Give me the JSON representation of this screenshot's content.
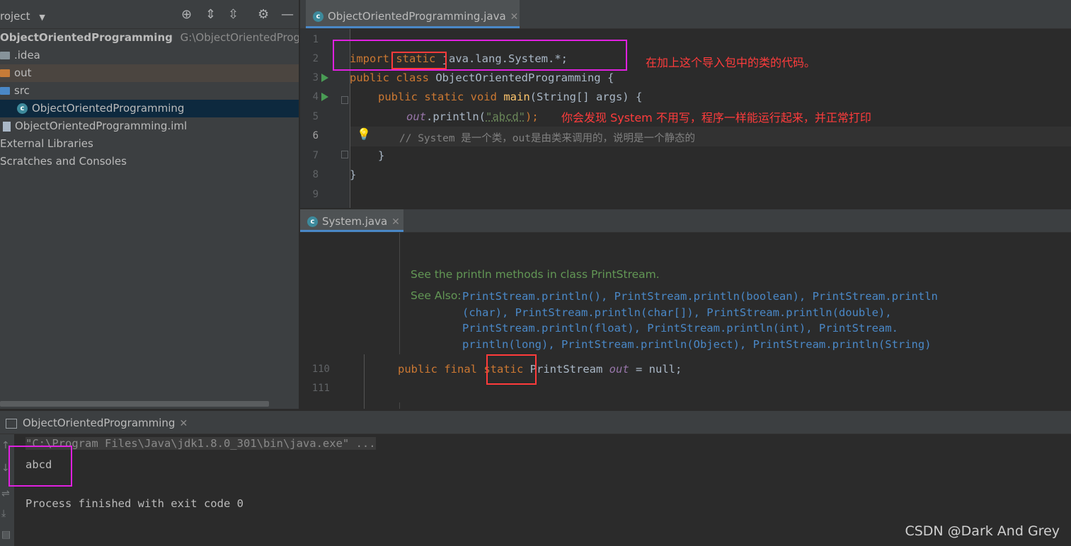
{
  "project": {
    "header": "roject",
    "tree": [
      {
        "label": ".idea",
        "icon": "folder-icon"
      },
      {
        "label": "out",
        "icon": "folder-icon"
      },
      {
        "label": "src",
        "icon": "folder-icon"
      },
      {
        "label": "ObjectOrientedProgramming",
        "icon": "java-class-icon"
      },
      {
        "label": "ObjectOrientedProgramming.iml",
        "icon": "file-icon"
      },
      {
        "label": "External Libraries",
        "icon": ""
      },
      {
        "label": "Scratches and Consoles",
        "icon": ""
      }
    ],
    "root_name": "ObjectOrientedProgramming",
    "root_path": "G:\\ObjectOrientedProgram"
  },
  "editor": {
    "tab_label": "ObjectOrientedProgramming.java",
    "line_numbers": [
      "1",
      "2",
      "3",
      "4",
      "5",
      "6",
      "7",
      "8",
      "9"
    ],
    "code": {
      "l2_import": "import",
      "l2_static": "static",
      "l2_rest": "java.lang.System.*;",
      "l3_kw": "public class",
      "l3_name": "ObjectOrientedProgramming {",
      "l4_kw": "public static void",
      "l4_main": "main",
      "l4_rest": "(String[] args) {",
      "l5_out": "out",
      "l5_call": ".println(",
      "l5_str": "\"abcd\"",
      "l5_end": ");",
      "l6_comment": "// System 是一个类，out是由类来调用的，说明是一个静态的",
      "l7": "}",
      "l8": "}"
    },
    "annotation_1": "在加上这个导入包中的类的代码。",
    "annotation_2": "你会发现 System 不用写，程序一样能运行起来，并正常打印"
  },
  "editor2": {
    "tab_label": "System.java",
    "doc_text": "See the println methods in class PrintStream.",
    "see_also_label": "See Also:",
    "see_also_lines": [
      "PrintStream.println(), PrintStream.println(boolean), PrintStream.println",
      "(char), PrintStream.println(char[]), PrintStream.println(double),",
      "PrintStream.println(float), PrintStream.println(int), PrintStream.",
      "println(long), PrintStream.println(Object), PrintStream.println(String)"
    ],
    "ln_110": "110",
    "ln_111": "111",
    "l110_kw": "public final",
    "l110_static": "static",
    "l110_type": "PrintStream",
    "l110_out": "out",
    "l110_rest": "= null;"
  },
  "run": {
    "tab_label": "ObjectOrientedProgramming",
    "command": "\"C:\\Program Files\\Java\\jdk1.8.0_301\\bin\\java.exe\" ...",
    "output": "abcd",
    "finished": "Process finished with exit code 0"
  },
  "watermark": "CSDN @Dark And Grey",
  "colors": {
    "accent": "#4a88c7",
    "annotation": "#ff3c3c",
    "highlight_box": "#e020e0"
  }
}
